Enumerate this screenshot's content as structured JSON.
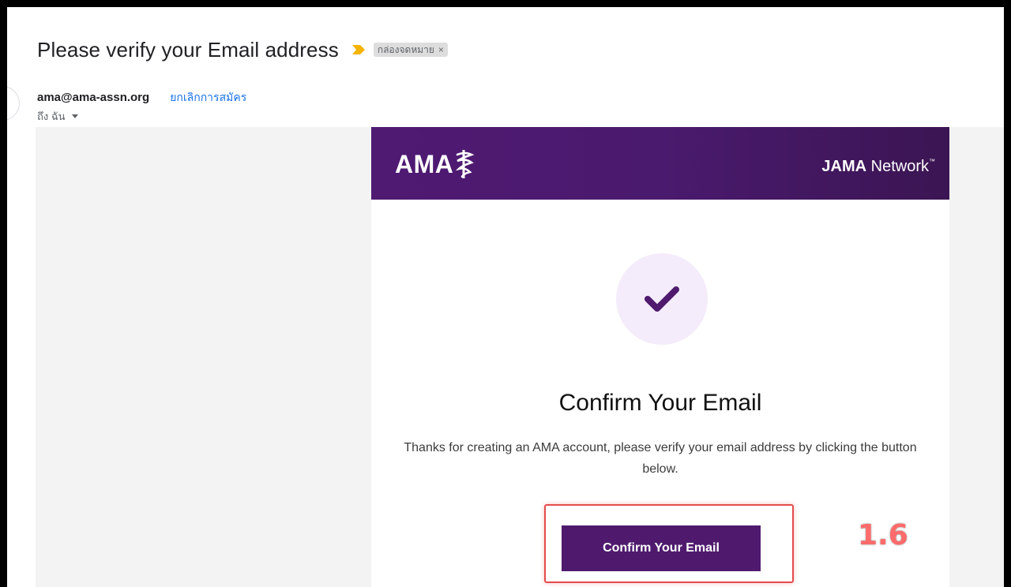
{
  "email": {
    "subject": "Please verify your Email address",
    "label": "กล่องจดหมาย",
    "label_close": "×",
    "sender": "ama@ama-assn.org",
    "unsubscribe": "ยกเลิกการสมัคร",
    "to": "ถึง ฉัน"
  },
  "message": {
    "logo_text": "AMA",
    "network_brand": "JAMA",
    "network_word": "Network",
    "network_tm": "™",
    "headline": "Confirm Your Email",
    "blurb": "Thanks for creating an AMA account, please verify your email address by clicking the button below.",
    "cta_label": "Confirm Your Email"
  },
  "annotation": {
    "step": "1.6"
  },
  "colors": {
    "brand_purple": "#4f1a6e",
    "highlight_red": "#e44c4c",
    "link_blue": "#1a73e8"
  }
}
